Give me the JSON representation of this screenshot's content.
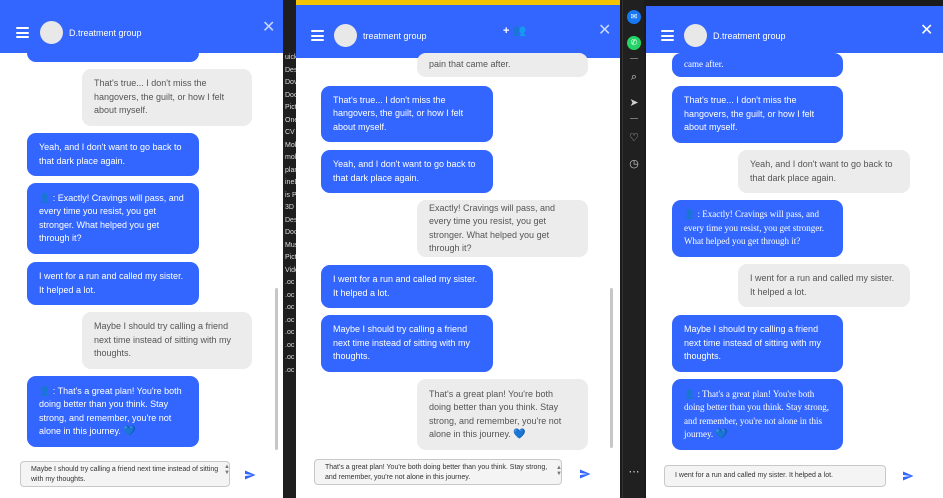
{
  "desktop": {
    "strip_items": [
      "uick",
      "Des",
      "Dov",
      "Doc",
      "Pict",
      "One",
      "CV v",
      "Mob",
      "mol",
      "plan",
      "ineD",
      "is P",
      "3D O",
      "Des",
      "Doc",
      "Mus",
      "Pict",
      "Vide",
      ".oc",
      ".oc",
      ".oc",
      ".oc",
      ".oc",
      ".oc",
      ".oc",
      ".oc"
    ]
  },
  "rail": {
    "icons": [
      "messenger-icon",
      "whatsapp-icon",
      "search-icon",
      "send-icon",
      "heart-icon",
      "clock-icon",
      "more-icon"
    ]
  },
  "windows": [
    {
      "title": "D.treatment group",
      "input_value": "Maybe I should try calling a friend next time instead of sitting with my thoughts.",
      "messages": [
        {
          "from": "them",
          "text": "That's true... I don't miss the hangovers, the guilt, or how I felt about myself."
        },
        {
          "from": "me",
          "text": "Yeah, and I don't want to go back to that dark place again."
        },
        {
          "from": "me",
          "text": ": Exactly! Cravings will pass, and every time you resist, you get stronger. What helped you get through it?",
          "bot": true
        },
        {
          "from": "me",
          "text": "I went for a run and called my sister. It helped a lot."
        },
        {
          "from": "them",
          "text": "Maybe I should try calling a friend next time instead of sitting with my thoughts."
        },
        {
          "from": "me",
          "text": ": That's a great plan! You're both doing better than you think. Stay strong, and remember, you're not alone in this journey.",
          "bot": true,
          "heart": true
        }
      ]
    },
    {
      "title": "treatment group",
      "input_value": "That's a great plan! You're both doing better than you think. Stay strong, and remember, you're not alone in this journey.",
      "messages": [
        {
          "from": "them",
          "text": "pain that came after."
        },
        {
          "from": "me",
          "text": "That's true... I don't miss the hangovers, the guilt, or how I felt about myself."
        },
        {
          "from": "me",
          "text": "Yeah, and I don't want to go back to that dark place again."
        },
        {
          "from": "them",
          "text": "Exactly! Cravings will pass, and every time you resist, you get stronger. What helped you get through it?"
        },
        {
          "from": "me",
          "text": "I went for a run and called my sister. It helped a lot."
        },
        {
          "from": "me",
          "text": "Maybe I should try calling a friend next time instead of sitting with my thoughts."
        },
        {
          "from": "them",
          "text": "That's a great plan! You're both doing better than you think. Stay strong, and remember, you're not alone in this journey.",
          "heart": true
        }
      ]
    },
    {
      "title": "D.treatment group",
      "input_value": "I went for a run and called my sister. It helped a lot.",
      "messages": [
        {
          "from": "me",
          "text": "came after."
        },
        {
          "from": "me",
          "text": "That's true... I don't miss the hangovers, the guilt, or how I felt about myself."
        },
        {
          "from": "them",
          "text": "Yeah, and I don't want to go back to that dark place again."
        },
        {
          "from": "me",
          "text": ": Exactly! Cravings will pass, and every time you resist, you get stronger. What helped you get through it?",
          "bot": true
        },
        {
          "from": "them",
          "text": "I went for a run and called my sister. It helped a lot."
        },
        {
          "from": "me",
          "text": "Maybe I should try calling a friend next time instead of sitting with my thoughts."
        },
        {
          "from": "me",
          "text": ": That's a great plan! You're both doing better than you think. Stay strong, and remember, you're not alone in this journey.",
          "bot": true,
          "heart": true
        }
      ]
    }
  ],
  "icons": {
    "heart": "💙",
    "bot": "person-icon",
    "send": "send-icon",
    "add_group": "add-group-icon",
    "close": "close-icon",
    "menu": "menu-icon"
  }
}
